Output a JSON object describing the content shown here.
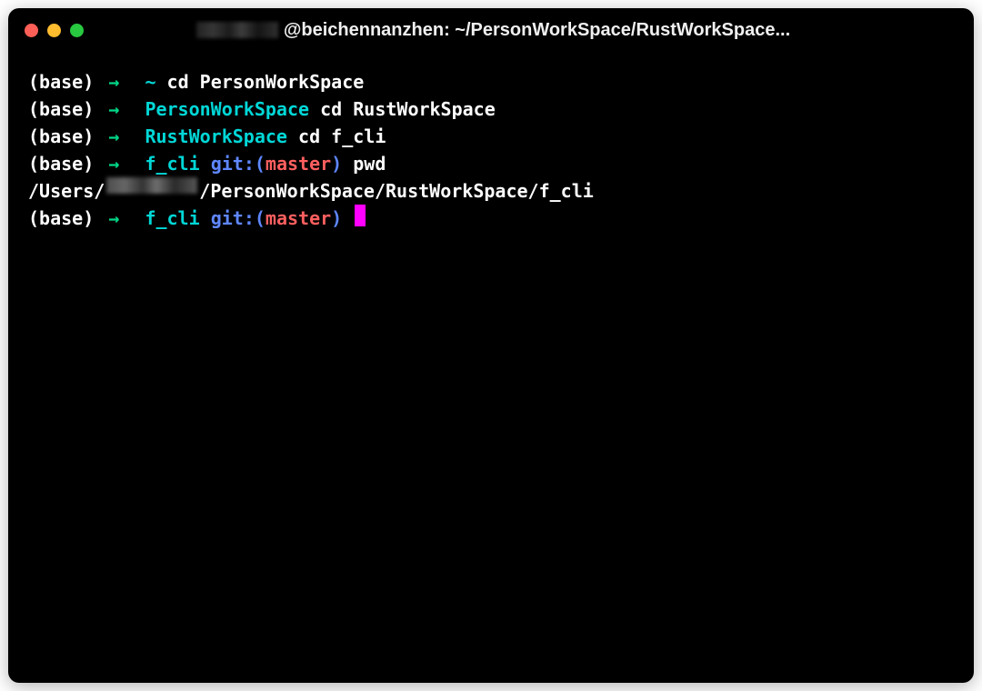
{
  "window": {
    "title_suffix": "@beichennanzhen: ~/PersonWorkSpace/RustWorkSpace..."
  },
  "prompt": {
    "env": "(base)",
    "arrow": "→",
    "git_label": "git:",
    "git_branch": "master"
  },
  "lines": [
    {
      "dir": "~",
      "cmd": "cd PersonWorkSpace"
    },
    {
      "dir": "PersonWorkSpace",
      "cmd": "cd RustWorkSpace"
    },
    {
      "dir": "RustWorkSpace",
      "cmd": "cd f_cli"
    },
    {
      "dir": "f_cli",
      "git": true,
      "cmd": "pwd"
    }
  ],
  "output": {
    "prefix": "/Users/",
    "suffix": "/PersonWorkSpace/RustWorkSpace/f_cli"
  },
  "current_prompt": {
    "dir": "f_cli",
    "git": true
  }
}
